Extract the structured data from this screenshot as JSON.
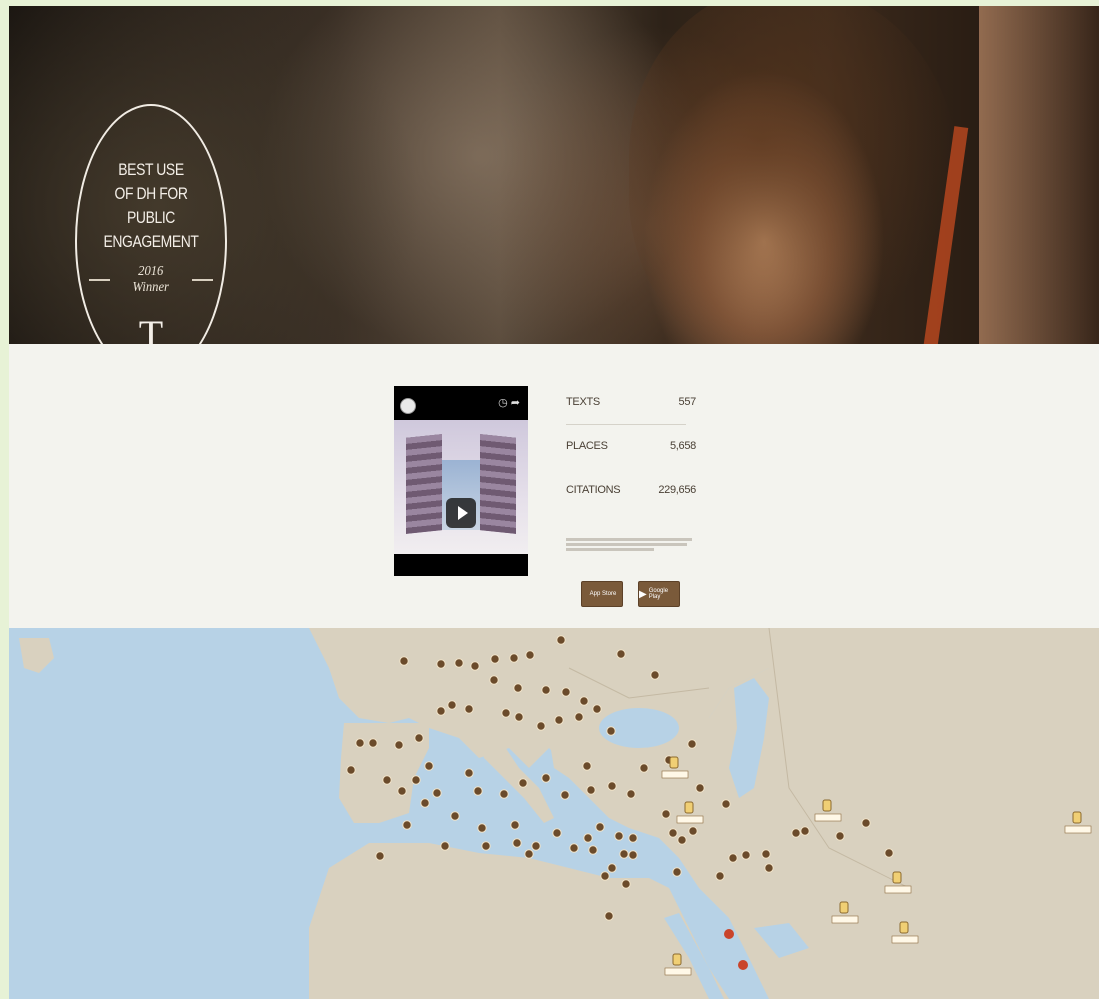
{
  "hero": {
    "award": {
      "title_lines": [
        "BEST USE",
        "OF DH FOR PUBLIC",
        "ENGAGEMENT"
      ],
      "title": "BEST USE OF DH FOR PUBLIC ENGAGEMENT",
      "year": "2016 Winner",
      "monogram": "T"
    }
  },
  "stats": {
    "rows": [
      {
        "label": "TEXTS",
        "value": "557"
      },
      {
        "label": "PLACES",
        "value": "5,658"
      },
      {
        "label": "CITATIONS",
        "value": "229,656"
      }
    ],
    "app_buttons": [
      {
        "label": "App Store",
        "icon": "apple-icon"
      },
      {
        "label": "Google Play",
        "icon": "play-store-icon"
      }
    ]
  },
  "video": {
    "icons": [
      "clock-icon",
      "share-icon"
    ],
    "play_icon": "play-icon"
  },
  "map": {
    "water_color": "#b7d2e6",
    "land_color": "#d9d1bf",
    "marker_color": "#6b4b2b",
    "highlight_color": "#c9442b"
  }
}
